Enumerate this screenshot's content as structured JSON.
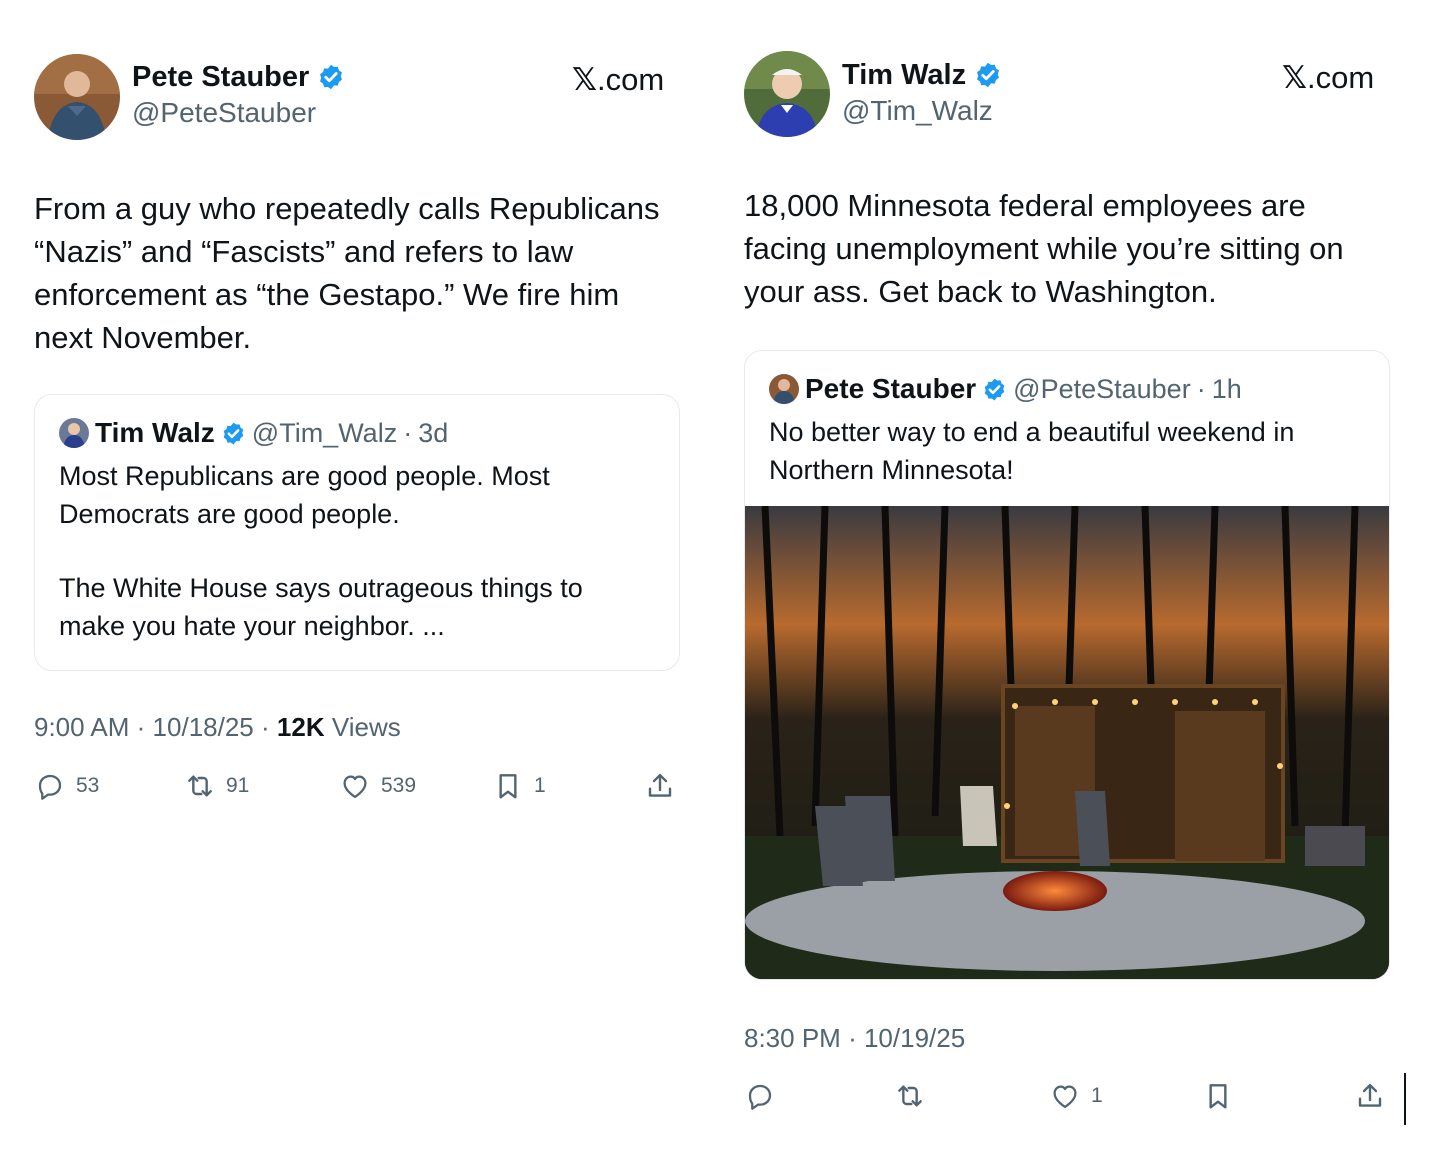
{
  "left_tweet": {
    "author": {
      "name": "Pete Stauber",
      "handle": "@PeteStauber",
      "avatar_icon": "person-photo-avatar"
    },
    "brand": {
      "x": "𝕏",
      "domain": ".com"
    },
    "text": [
      "From a guy who repeatedly calls Republicans",
      "“Nazis” and “Fascists” and refers to law",
      "enforcement as “the Gestapo.” We fire him",
      "next November."
    ],
    "quote": {
      "name": "Tim Walz",
      "handle": "@Tim_Walz",
      "sep": "·",
      "age": "3d",
      "lines": [
        "Most Republicans are good people. Most",
        "Democrats are good people.",
        "",
        "The White House says outrageous things to",
        "make you hate your neighbor. ..."
      ]
    },
    "time": "9:00 AM",
    "date": "10/18/25",
    "views_count": "12K",
    "views_label": "Views",
    "dot": "·",
    "actions": {
      "replies": "53",
      "reposts": "91",
      "likes": "539",
      "bookmarks": "1"
    }
  },
  "right_tweet": {
    "author": {
      "name": "Tim Walz",
      "handle": "@Tim_Walz",
      "avatar_icon": "person-photo-avatar"
    },
    "brand": {
      "x": "𝕏",
      "domain": ".com"
    },
    "text": [
      "18,000 Minnesota federal employees are",
      "facing unemployment while you’re sitting on",
      "your ass. Get back to Washington."
    ],
    "quote": {
      "name": "Pete Stauber",
      "handle": "@PeteStauber",
      "sep": "·",
      "age": "1h",
      "lines": [
        "No better way to end a beautiful weekend in",
        "Northern Minnesota!"
      ],
      "image_icon": "firepit-photo"
    },
    "time": "8:30 PM",
    "date": "10/19/25",
    "dot": "·",
    "actions": {
      "replies": "",
      "reposts": "",
      "likes": "1",
      "bookmarks": ""
    }
  },
  "colors": {
    "text": "#0f1419",
    "secondary": "#536471",
    "verified": "#1d9bf0",
    "border": "#e6e9ec"
  }
}
